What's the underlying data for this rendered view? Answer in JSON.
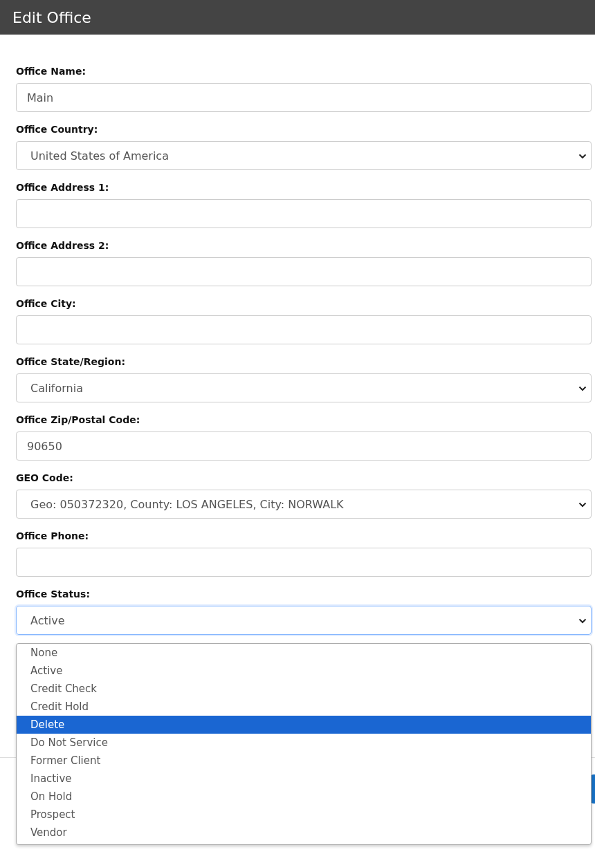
{
  "header": {
    "title": "Edit Office"
  },
  "fields": [
    {
      "label": "Office Name:",
      "kind": "input",
      "value": "Main",
      "focused": false
    },
    {
      "label": "Office Country:",
      "kind": "select",
      "value": "United States of America",
      "focused": false
    },
    {
      "label": "Office Address 1:",
      "kind": "input",
      "focused": false
    },
    {
      "label": "Office Address 2:",
      "kind": "input",
      "focused": false
    },
    {
      "label": "Office City:",
      "kind": "input",
      "focused": false
    },
    {
      "label": "Office State/Region:",
      "kind": "select",
      "value": "California",
      "focused": false
    },
    {
      "label": "Office Zip/Postal Code:",
      "kind": "input",
      "value": "90650",
      "focused": false
    },
    {
      "label": "GEO Code:",
      "kind": "select",
      "value": "Geo: 050372320, County: LOS ANGELES, City: NORWALK",
      "focused": false
    },
    {
      "label": "Office Phone:",
      "kind": "input",
      "focused": false
    },
    {
      "label": "Office Status:",
      "kind": "select",
      "value": "Active",
      "focused": true
    }
  ],
  "dropdown": {
    "options": [
      {
        "label": "None",
        "selected": false
      },
      {
        "label": "Active",
        "selected": false
      },
      {
        "label": "Credit Check",
        "selected": false
      },
      {
        "label": "Credit Hold",
        "selected": false
      },
      {
        "label": "Delete",
        "selected": true
      },
      {
        "label": "Do Not Service",
        "selected": false
      },
      {
        "label": "Former Client",
        "selected": false
      },
      {
        "label": "Inactive",
        "selected": false
      },
      {
        "label": "On Hold",
        "selected": false
      },
      {
        "label": "Prospect",
        "selected": false
      },
      {
        "label": "Vendor",
        "selected": false
      }
    ]
  }
}
